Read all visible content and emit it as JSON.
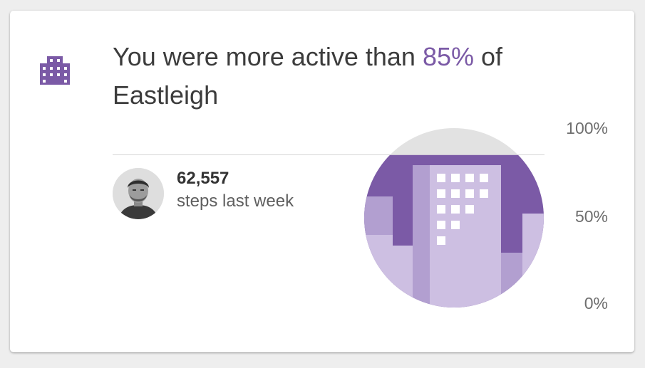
{
  "card": {
    "headline_prefix": "You were more active than",
    "headline_percent": "85%",
    "headline_suffix": "of",
    "headline_place": "Eastleigh",
    "icon": "city-buildings-icon",
    "accent_color": "#7b5aa6"
  },
  "user": {
    "avatar": "user-avatar-photo",
    "steps_value": "62,557",
    "steps_label": "steps last week"
  },
  "scale": {
    "labels": [
      "100%",
      "50%",
      "0%"
    ],
    "fill_percent": 85
  }
}
